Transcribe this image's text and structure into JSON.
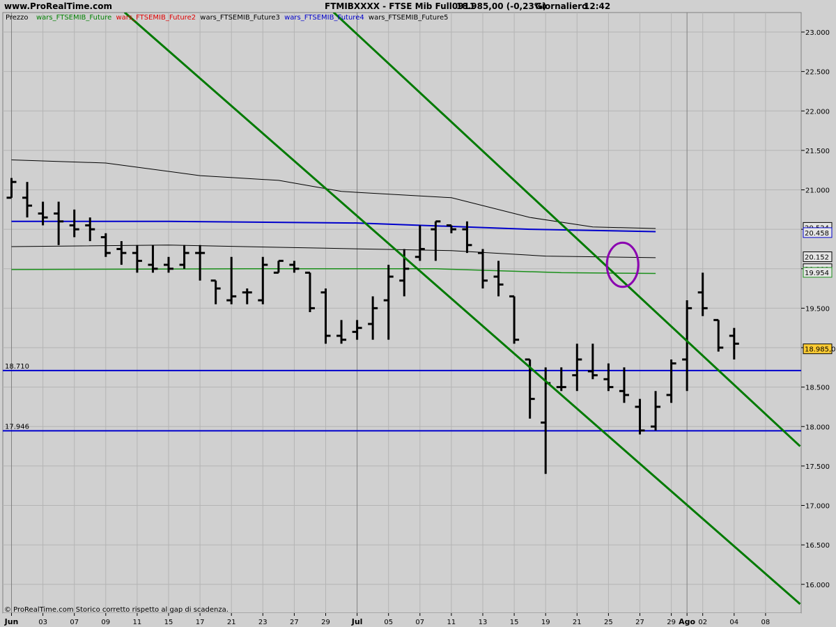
{
  "header": {
    "site": "www.ProRealTime.com",
    "title": "FTMIBXXXX - FTSE Mib Full0911",
    "last": "18.985,00 (-0,23%)",
    "period": "Giornaliero",
    "time": "12:42"
  },
  "legend": {
    "prezzo": "Prezzo",
    "items": [
      {
        "text": "wars_FTSEMIB_Future",
        "color": "#008000"
      },
      {
        "text": "wars_FTSEMIB_Future2",
        "color": "#e00000"
      },
      {
        "text": "wars_FTSEMIB_Future3",
        "color": "#000000"
      },
      {
        "text": "wars_FTSEMIB_Future4",
        "color": "#0000cc"
      },
      {
        "text": "wars_FTSEMIB_Future5",
        "color": "#000000"
      }
    ]
  },
  "footer": {
    "copyright": "© ProRealTime.com  Storico corretto rispetto al gap di scadenza."
  },
  "colors": {
    "background": "#d0d0d0",
    "grid": "#b4b4b4",
    "bars": "#000000",
    "trend": "#007a00",
    "support": "#0000cc",
    "ma_blue": "#0000cc",
    "ma_green": "#1a8f1a",
    "ma_black": "#000000",
    "circle": "#8a00b0"
  },
  "chart_data": {
    "type": "ohlc",
    "ylim": [
      15700,
      23300
    ],
    "y_ticks": [
      "23.000",
      "22.500",
      "22.000",
      "21.500",
      "21.000",
      "20.500",
      "20.000",
      "19.500",
      "19.000",
      "18.500",
      "18.000",
      "17.500",
      "17.000",
      "16.500",
      "16.000"
    ],
    "x_ticks": [
      {
        "label": "Jun",
        "idx": 0,
        "bold": true
      },
      {
        "label": "03",
        "idx": 2
      },
      {
        "label": "07",
        "idx": 4
      },
      {
        "label": "09",
        "idx": 6
      },
      {
        "label": "11",
        "idx": 8
      },
      {
        "label": "15",
        "idx": 10
      },
      {
        "label": "17",
        "idx": 12
      },
      {
        "label": "21",
        "idx": 14
      },
      {
        "label": "23",
        "idx": 16
      },
      {
        "label": "27",
        "idx": 18
      },
      {
        "label": "29",
        "idx": 20
      },
      {
        "label": "Jul",
        "idx": 22,
        "bold": true
      },
      {
        "label": "05",
        "idx": 24
      },
      {
        "label": "07",
        "idx": 26
      },
      {
        "label": "11",
        "idx": 28
      },
      {
        "label": "13",
        "idx": 30
      },
      {
        "label": "15",
        "idx": 32
      },
      {
        "label": "19",
        "idx": 34
      },
      {
        "label": "21",
        "idx": 36
      },
      {
        "label": "25",
        "idx": 38
      },
      {
        "label": "27",
        "idx": 40
      },
      {
        "label": "29",
        "idx": 42
      },
      {
        "label": "Ago",
        "idx": 43,
        "bold": true
      },
      {
        "label": "02",
        "idx": 44
      },
      {
        "label": "04",
        "idx": 46
      },
      {
        "label": "08",
        "idx": 48
      }
    ],
    "ohlc": [
      [
        20900,
        21150,
        20900,
        21100
      ],
      [
        20900,
        21100,
        20650,
        20800
      ],
      [
        20700,
        20850,
        20550,
        20650
      ],
      [
        20700,
        20850,
        20300,
        20600
      ],
      [
        20550,
        20750,
        20400,
        20500
      ],
      [
        20550,
        20650,
        20350,
        20500
      ],
      [
        20400,
        20450,
        20150,
        20200
      ],
      [
        20250,
        20350,
        20050,
        20200
      ],
      [
        20200,
        20300,
        19950,
        20100
      ],
      [
        20050,
        20300,
        19950,
        20000
      ],
      [
        20050,
        20150,
        19950,
        20000
      ],
      [
        20050,
        20300,
        20000,
        20200
      ],
      [
        20200,
        20300,
        19850,
        20200
      ],
      [
        19850,
        19850,
        19550,
        19750
      ],
      [
        19600,
        20150,
        19550,
        19650
      ],
      [
        19700,
        19750,
        19550,
        19700
      ],
      [
        19600,
        20150,
        19550,
        20050
      ],
      [
        19950,
        20100,
        19950,
        20100
      ],
      [
        20050,
        20100,
        19950,
        20000
      ],
      [
        19950,
        19950,
        19450,
        19500
      ],
      [
        19700,
        19750,
        19050,
        19150
      ],
      [
        19150,
        19350,
        19050,
        19100
      ],
      [
        19200,
        19350,
        19100,
        19250
      ],
      [
        19300,
        19650,
        19100,
        19500
      ],
      [
        19600,
        20050,
        19100,
        19900
      ],
      [
        19850,
        20250,
        19650,
        20000
      ],
      [
        20150,
        20550,
        20100,
        20250
      ],
      [
        20500,
        20600,
        20100,
        20600
      ],
      [
        20550,
        20550,
        20450,
        20500
      ],
      [
        20500,
        20600,
        20200,
        20300
      ],
      [
        20200,
        20250,
        19750,
        19850
      ],
      [
        19900,
        20100,
        19650,
        19800
      ],
      [
        19650,
        19650,
        19050,
        19100
      ],
      [
        18850,
        18850,
        18100,
        18350
      ],
      [
        18050,
        18750,
        17400,
        18550
      ],
      [
        18500,
        18750,
        18450,
        18500
      ],
      [
        18650,
        19050,
        18450,
        18850
      ],
      [
        18700,
        19050,
        18600,
        18650
      ],
      [
        18600,
        18800,
        18450,
        18500
      ],
      [
        18450,
        18750,
        18300,
        18400
      ],
      [
        18250,
        18350,
        17900,
        17950
      ],
      [
        18000,
        18450,
        17950,
        18250
      ],
      [
        18400,
        18850,
        18300,
        18800
      ],
      [
        18850,
        19600,
        18450,
        19500
      ],
      [
        19700,
        19950,
        19400,
        19500
      ],
      [
        19350,
        19350,
        18950,
        19000
      ],
      [
        19150,
        19250,
        18850,
        19050
      ]
    ],
    "series": [
      {
        "name": "wars_FTSEMIB_Future",
        "color": "#1a8f1a",
        "width": 1.5,
        "points": [
          [
            0,
            19990
          ],
          [
            15,
            20000
          ],
          [
            27,
            20000
          ],
          [
            35,
            19950
          ],
          [
            41,
            19940
          ]
        ]
      },
      {
        "name": "wars_FTSEMIB_Future3",
        "color": "#000000",
        "width": 1,
        "points": [
          [
            0,
            20280
          ],
          [
            10,
            20300
          ],
          [
            20,
            20260
          ],
          [
            28,
            20230
          ],
          [
            34,
            20160
          ],
          [
            41,
            20140
          ]
        ]
      },
      {
        "name": "wars_FTSEMIB_Future4",
        "color": "#0000cc",
        "width": 2,
        "points": [
          [
            0,
            20600
          ],
          [
            10,
            20600
          ],
          [
            22,
            20580
          ],
          [
            33,
            20500
          ],
          [
            41,
            20470
          ]
        ]
      },
      {
        "name": "wars_FTSEMIB_Future5",
        "color": "#000000",
        "width": 1,
        "points": [
          [
            0,
            21380
          ],
          [
            6,
            21340
          ],
          [
            12,
            21180
          ],
          [
            17,
            21120
          ],
          [
            21,
            20980
          ],
          [
            28,
            20900
          ],
          [
            33,
            20650
          ],
          [
            37,
            20530
          ],
          [
            41,
            20510
          ]
        ]
      }
    ],
    "trendlines": [
      {
        "from": [
          7.2,
          23250
        ],
        "to": [
          50.2,
          15750
        ]
      },
      {
        "from": [
          20.5,
          23250
        ],
        "to": [
          50.2,
          17750
        ]
      }
    ],
    "horizontal_lines": [
      {
        "value": 18710,
        "label": "18.710"
      },
      {
        "value": 17946,
        "label": "17.946"
      }
    ],
    "right_labels": [
      {
        "value": 20524,
        "text": "20.524"
      },
      {
        "value": 20458,
        "text": "20.458",
        "color": "#0000cc"
      },
      {
        "value": 20152,
        "text": "20.152",
        "color": "#000000"
      },
      {
        "value": 20000,
        "text": "20.000"
      },
      {
        "value": 19954,
        "text": "19.954",
        "color": "#1a8f1a"
      },
      {
        "value": 18985,
        "text": "18.985,0",
        "color": "#000000",
        "fill": "#ffcc33"
      }
    ],
    "circle": {
      "cx": 38.9,
      "cy": 20050,
      "rx": 1.0,
      "ry": 280
    }
  }
}
